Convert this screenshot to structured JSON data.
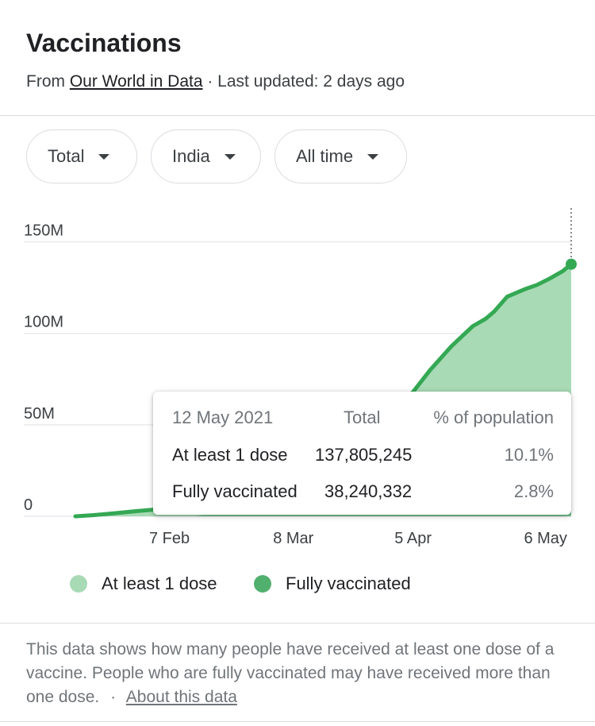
{
  "header": {
    "title": "Vaccinations",
    "source_prefix": "From",
    "source_name": "Our World in Data",
    "updated": "· Last updated: 2 days ago"
  },
  "filters": [
    {
      "label": "Total"
    },
    {
      "label": "India"
    },
    {
      "label": "All time"
    }
  ],
  "tooltip": {
    "date": "12 May 2021",
    "col_total": "Total",
    "col_pct": "% of population",
    "rows": [
      {
        "label": "At least 1 dose",
        "total": "137,805,245",
        "pct": "10.1%"
      },
      {
        "label": "Fully vaccinated",
        "total": "38,240,332",
        "pct": "2.8%"
      }
    ]
  },
  "legend": [
    {
      "label": "At least 1 dose",
      "color": "#a8dab5"
    },
    {
      "label": "Fully vaccinated",
      "color": "#52b06f"
    }
  ],
  "footnote": {
    "text": "This data shows how many people have received at least one dose of a vaccine. People who are fully vaccinated may have received more than one dose.",
    "separator": "·",
    "link": "About this data"
  },
  "colors": {
    "at_least_one_fill": "#a8dab5",
    "at_least_one_line": "#34a853",
    "fully_vaccinated": "#52b06f",
    "grid": "#e8eaed"
  },
  "chart_data": {
    "type": "area",
    "x_type": "date",
    "xlim": [
      "2021-01-16",
      "2021-05-12"
    ],
    "ylim": [
      0,
      165000000
    ],
    "y_ticks": [
      {
        "value": 0,
        "label": "0"
      },
      {
        "value": 50000000,
        "label": "50M"
      },
      {
        "value": 100000000,
        "label": "100M"
      },
      {
        "value": 150000000,
        "label": "150M"
      }
    ],
    "x_ticks": [
      {
        "value": "2021-02-07",
        "label": "7 Feb"
      },
      {
        "value": "2021-03-08",
        "label": "8 Mar"
      },
      {
        "value": "2021-04-05",
        "label": "5 Apr"
      },
      {
        "value": "2021-05-06",
        "label": "6 May"
      }
    ],
    "grid": true,
    "legend_position": "bottom",
    "highlight_x": "2021-05-12",
    "series": [
      {
        "name": "At least 1 dose",
        "points": [
          [
            "2021-01-16",
            0
          ],
          [
            "2021-01-20",
            600000
          ],
          [
            "2021-01-25",
            1600000
          ],
          [
            "2021-01-30",
            2800000
          ],
          [
            "2021-02-03",
            3600000
          ],
          [
            "2021-02-07",
            4700000
          ],
          [
            "2021-02-15",
            6500000
          ],
          [
            "2021-02-22",
            8000000
          ],
          [
            "2021-03-01",
            11000000
          ],
          [
            "2021-03-08",
            18000000
          ],
          [
            "2021-03-15",
            27000000
          ],
          [
            "2021-03-22",
            38000000
          ],
          [
            "2021-03-29",
            52000000
          ],
          [
            "2021-04-02",
            62000000
          ],
          [
            "2021-04-05",
            68000000
          ],
          [
            "2021-04-09",
            80000000
          ],
          [
            "2021-04-14",
            93000000
          ],
          [
            "2021-04-19",
            104000000
          ],
          [
            "2021-04-22",
            108000000
          ],
          [
            "2021-04-24",
            112000000
          ],
          [
            "2021-04-27",
            120000000
          ],
          [
            "2021-05-01",
            124000000
          ],
          [
            "2021-05-04",
            126500000
          ],
          [
            "2021-05-07",
            130000000
          ],
          [
            "2021-05-10",
            134000000
          ],
          [
            "2021-05-12",
            137805245
          ]
        ]
      },
      {
        "name": "Fully vaccinated",
        "points": [
          [
            "2021-02-13",
            0
          ],
          [
            "2021-05-12",
            38240332
          ]
        ]
      }
    ]
  }
}
